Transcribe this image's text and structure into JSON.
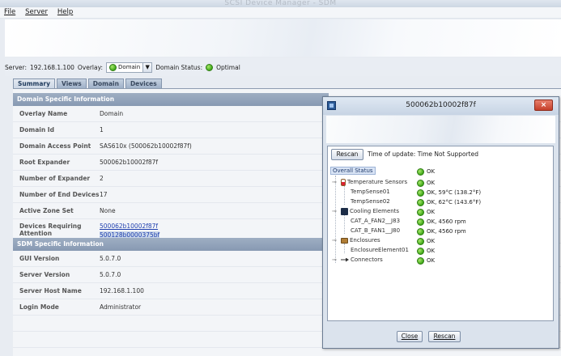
{
  "window": {
    "title": "SCSI Device Manager - SDM"
  },
  "menu": {
    "items": [
      "File",
      "Server",
      "Help"
    ]
  },
  "server_bar": {
    "server_label": "Server:",
    "server_value": "192.168.1.100",
    "overlay_label": "Overlay:",
    "overlay_value": "Domain",
    "domain_status_label": "Domain Status:",
    "domain_status_value": "Optimal"
  },
  "tabs": [
    "Summary",
    "Views",
    "Domain",
    "Devices"
  ],
  "domain_section": {
    "title": "Domain Specific Information",
    "rows": [
      {
        "key": "Overlay Name",
        "value": "Domain"
      },
      {
        "key": "Domain Id",
        "value": "1"
      },
      {
        "key": "Domain Access Point",
        "value": "SAS610x (500062b10002f87f)"
      },
      {
        "key": "Root Expander",
        "value": "500062b10002f87f"
      },
      {
        "key": "Number of Expander",
        "value": "2"
      },
      {
        "key": "Number of End Devices",
        "value": "17"
      },
      {
        "key": "Active Zone Set",
        "value": "None"
      },
      {
        "key": "Devices Requiring Attention",
        "links": [
          "500062b10002f87f",
          "500128b0000375bf"
        ]
      }
    ]
  },
  "sdm_section": {
    "title": "SDM Specific Information",
    "rows": [
      {
        "key": "GUI Version",
        "value": "5.0.7.0"
      },
      {
        "key": "Server Version",
        "value": "5.0.7.0"
      },
      {
        "key": "Server Host Name",
        "value": "192.168.1.100"
      },
      {
        "key": "Login Mode",
        "value": "Administrator"
      }
    ]
  },
  "dialog": {
    "title": "500062b10002f87f",
    "close_symbol": "×",
    "rescan_top_label": "Rescan",
    "update_text": "Time of update: Time Not Supported",
    "tree": {
      "header": "Overall Status",
      "header_status": "OK",
      "nodes": [
        {
          "label": "Temperature Sensors",
          "status": "OK"
        },
        {
          "label": "TempSense01",
          "status": "OK, 59°C (138.2°F)"
        },
        {
          "label": "TempSense02",
          "status": "OK, 62°C (143.6°F)"
        },
        {
          "label": "Cooling Elements",
          "status": "OK"
        },
        {
          "label": "CAT_A_FAN2__J83",
          "status": "OK, 4560 rpm"
        },
        {
          "label": "CAT_B_FAN1__J80",
          "status": "OK, 4560 rpm"
        },
        {
          "label": "Enclosures",
          "status": "OK"
        },
        {
          "label": "EnclosureElement01",
          "status": "OK"
        },
        {
          "label": "Connectors",
          "status": "OK"
        }
      ]
    },
    "close_label": "Close",
    "rescan_label": "Rescan"
  },
  "colors": {
    "status_ok": "#3fa818",
    "section_header": "#8799b2",
    "link": "#1f3fae"
  }
}
